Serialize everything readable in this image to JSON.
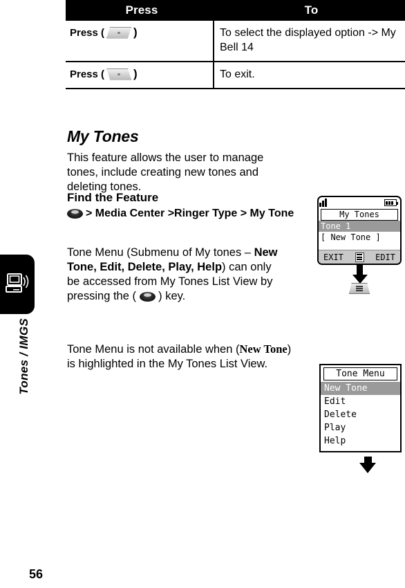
{
  "page": {
    "number": "56",
    "section_tab_label": "Tones / IMGS"
  },
  "key_table": {
    "headers": [
      "Press",
      "To"
    ],
    "rows": [
      {
        "press_label": "Press (",
        "press_close": ")",
        "key_icon": "right-soft-key-icon",
        "to": "To select the displayed option -> My Bell 14"
      },
      {
        "press_label": "Press (",
        "press_close": ")",
        "key_icon": "left-soft-key-icon",
        "to": "To exit."
      }
    ]
  },
  "content": {
    "heading": "My Tones",
    "intro": "This feature allows the user to manage tones, include creating new tones and deleting tones.",
    "find_the_feature_label": "Find the Feature",
    "find_path": "> Media Center >Ringer Type > My Tone",
    "note1": {
      "part1": "Tone Menu (Submenu of My tones – ",
      "bold": "New Tone, Edit, Delete, Play, Help",
      "part2": ") can only be accessed from My Tones List View by pressing the ( ",
      "part3": " ) key."
    },
    "note2": {
      "part1": "Tone Menu is not available when (",
      "serif_bold": "New Tone",
      "part2": ") is highlighted in the My Tones List View."
    }
  },
  "phone_display": {
    "title": "My Tones",
    "items": [
      {
        "label": "Tone 1",
        "selected": true
      },
      {
        "label": "[ New Tone ]",
        "selected": false
      }
    ],
    "softkeys": {
      "left": "EXIT",
      "right": "EDIT",
      "center_icon": "menu-icon"
    },
    "status": {
      "signal_icon": "signal-bars-icon",
      "battery_icon": "battery-full-icon"
    }
  },
  "tone_menu": {
    "title": "Tone Menu",
    "items": [
      {
        "label": "New Tone",
        "selected": true
      },
      {
        "label": "Edit",
        "selected": false
      },
      {
        "label": "Delete",
        "selected": false
      },
      {
        "label": "Play",
        "selected": false
      },
      {
        "label": "Help",
        "selected": false
      }
    ]
  },
  "colors": {
    "header_bg": "#000000",
    "highlight": "#9a9a9a",
    "softbar": "#c9c9c9"
  }
}
